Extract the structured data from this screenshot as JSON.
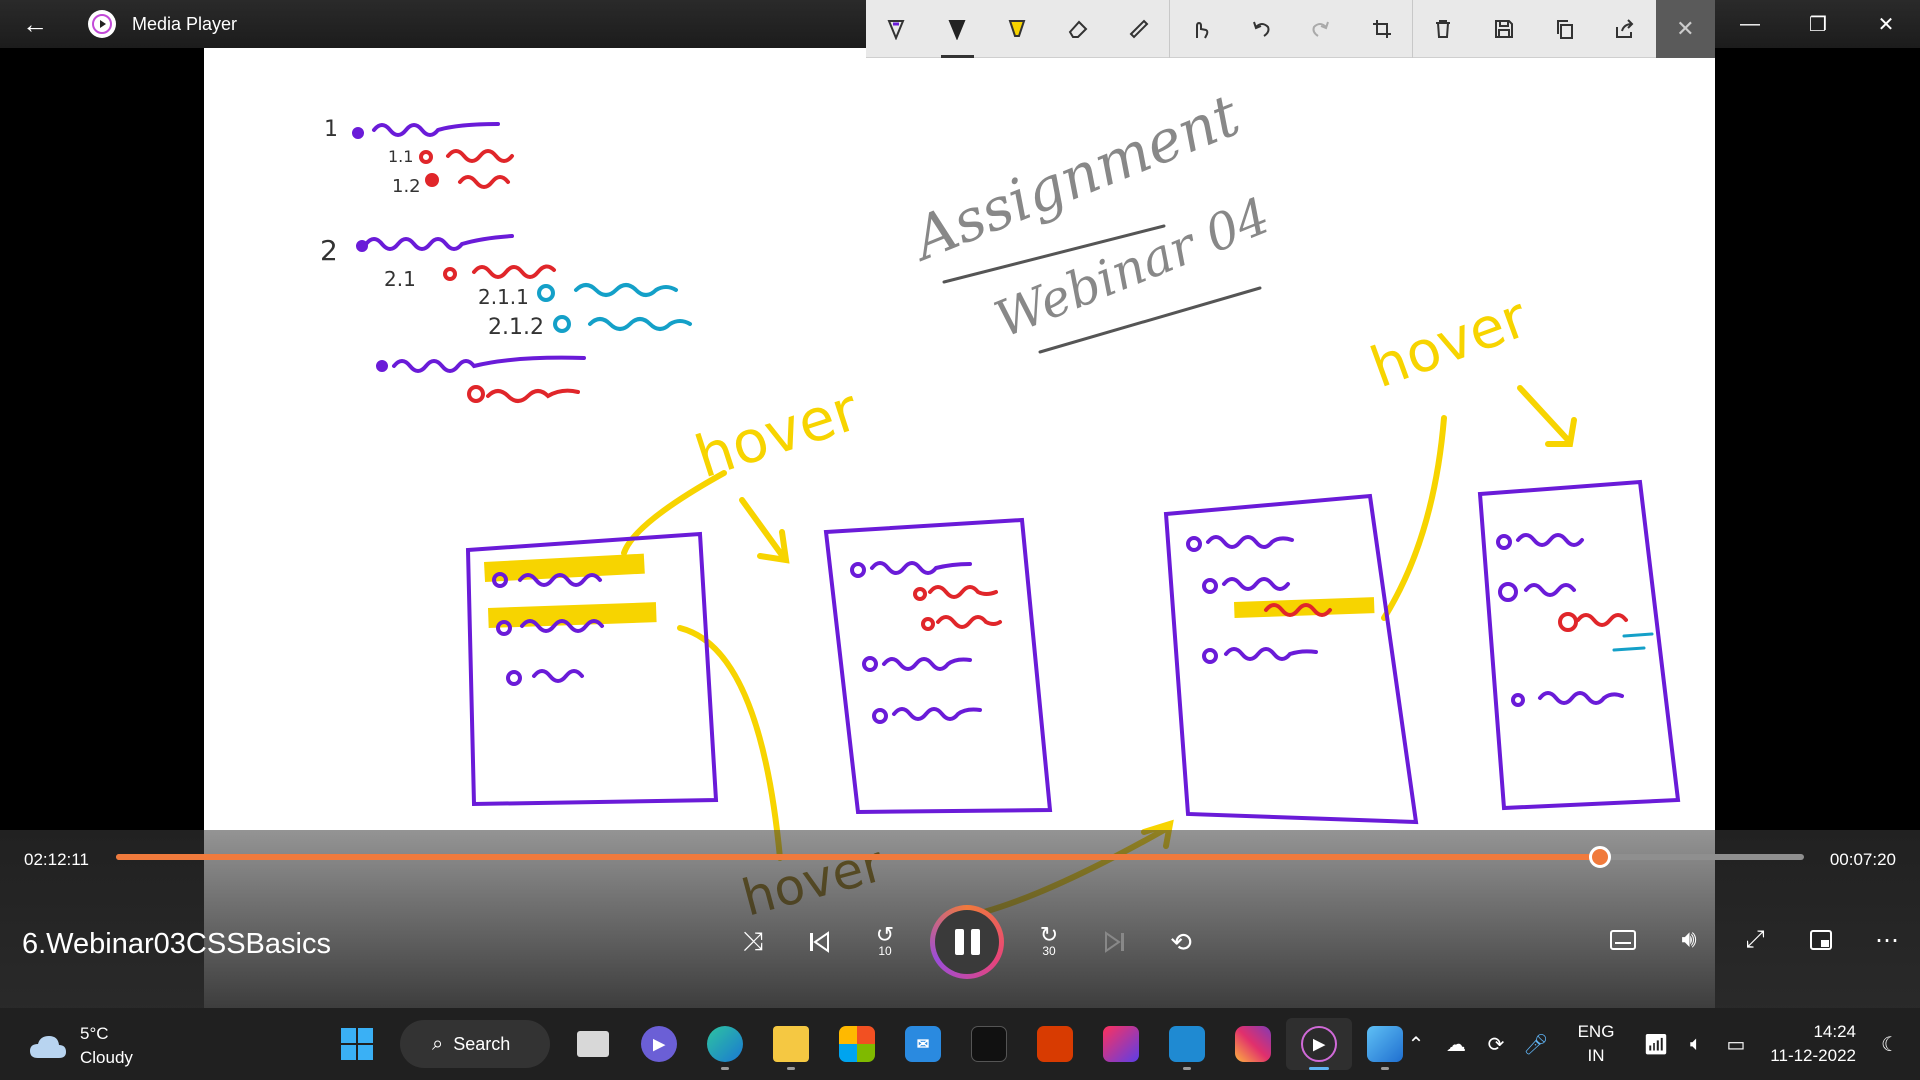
{
  "app": {
    "title": "Media Player"
  },
  "ink_toolbar": {
    "tools": [
      "ballpoint-pen-icon",
      "pen-icon",
      "highlighter-icon",
      "eraser-icon",
      "ruler-icon",
      "touch-writing-icon",
      "undo-icon",
      "redo-icon",
      "crop-icon",
      "delete-icon",
      "save-icon",
      "copy-icon",
      "share-icon",
      "close-icon"
    ]
  },
  "whiteboard": {
    "heading_1": "Assignment",
    "heading_2": "Webinar 04",
    "hover_labels": [
      "hover",
      "hover",
      "hover"
    ],
    "outline_numbers": [
      "1",
      "1.1",
      "1.2",
      "2",
      "2.1",
      "2.1.1",
      "2.1.2"
    ]
  },
  "player": {
    "current_time": "02:12:11",
    "remaining_time": "00:07:20",
    "progress": 0.879,
    "video_title": "6.Webinar03CSSBasics",
    "skip_back_label": "10",
    "skip_forward_label": "30",
    "accent": "#f07a3c"
  },
  "taskbar": {
    "weather_temp": "5°C",
    "weather_desc": "Cloudy",
    "search_label": "Search",
    "lang_line1": "ENG",
    "lang_line2": "IN",
    "time": "14:24",
    "date": "11-12-2022"
  }
}
